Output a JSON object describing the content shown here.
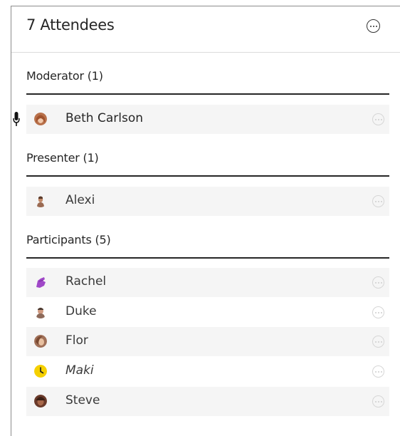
{
  "header": {
    "title": "7 Attendees",
    "more_icon": "more-options-icon"
  },
  "sections": {
    "moderator": {
      "label": "Moderator (1)"
    },
    "presenter": {
      "label": "Presenter (1)"
    },
    "participants": {
      "label": "Participants (5)"
    }
  },
  "attendees": {
    "beth": {
      "name": "Beth Carlson",
      "avatar_color": "#b8704a",
      "icon": "microphone-icon"
    },
    "alexi": {
      "name": "Alexi",
      "avatar_color": "#9a6a52"
    },
    "rachel": {
      "name": "Rachel",
      "avatar_color": "#a048c8"
    },
    "duke": {
      "name": "Duke",
      "avatar_color": "#8d6a5a"
    },
    "flor": {
      "name": "Flor",
      "avatar_color": "#a07058"
    },
    "maki": {
      "name": "Maki",
      "avatar_color": "#f5d000",
      "icon": "clock-icon"
    },
    "steve": {
      "name": "Steve",
      "avatar_color": "#6a3a2a"
    }
  }
}
